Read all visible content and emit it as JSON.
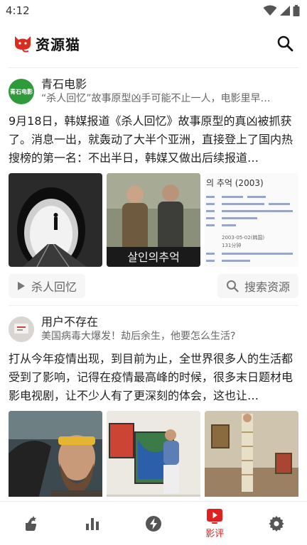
{
  "status_bar": {
    "time": "4:12"
  },
  "app_bar": {
    "title": "资源猫"
  },
  "feed": [
    {
      "source": "青石电影",
      "avatar_text": "青石电影",
      "headline": "“杀人回忆”故事原型凶手可能不止一人，电影里早…",
      "summary": "9月18日，韩媒报道《杀人回忆》故事原型的真凶被抓获了。消息一出，就轰动了大半个亚洲，直接登上了国内热搜榜的第一名：不出半日，韩媒又做出后续报道…",
      "thumb_poster_text": "살인의추억",
      "thumb_info_title": "의 추억 (2003)",
      "thumb_info_date": "2003-05-02(韩国)",
      "thumb_info_runtime": "131分钟",
      "movie_chip": "杀人回忆",
      "search_chip": "搜索资源"
    },
    {
      "source": "用户不存在",
      "headline": "美国病毒大爆发！劫后余生，他要怎么生活?",
      "summary": "打从今年疫情出现，到目前为止，全世界很多人的生活都受到了影响，记得在疫情最高峰的时候，很多末日题材电影电视剧，让不少人有了更深刻的体会，这也让…"
    }
  ],
  "bottom_nav": [
    {
      "icon": "hand-star-icon",
      "label": ""
    },
    {
      "icon": "bar-chart-icon",
      "label": ""
    },
    {
      "icon": "lightning-icon",
      "label": ""
    },
    {
      "icon": "play-icon",
      "label": "影评",
      "active": true
    },
    {
      "icon": "gear-icon",
      "label": ""
    }
  ],
  "colors": {
    "accent": "#e02020",
    "brand_green": "#2e9b3b",
    "icon": "#555555"
  }
}
